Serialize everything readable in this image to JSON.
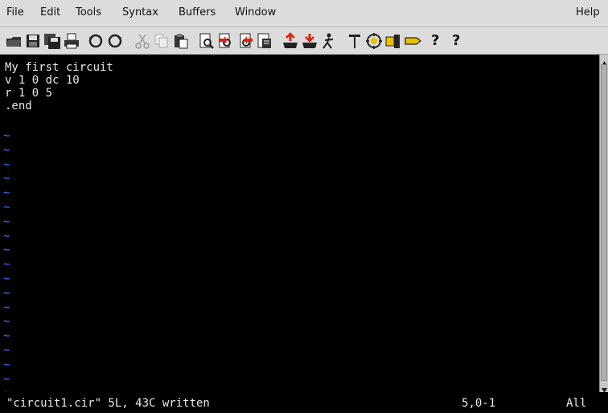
{
  "menubar": {
    "items": [
      "File",
      "Edit",
      "Tools",
      "Syntax",
      "Buffers",
      "Window"
    ],
    "help": "Help"
  },
  "toolbar": {
    "icons": [
      "open-icon",
      "save-icon",
      "save-all-icon",
      "print-icon",
      "undo-icon",
      "redo-icon",
      "cut-icon",
      "copy-icon",
      "paste-icon",
      "find-icon",
      "find-next-icon",
      "find-prev-icon",
      "load-session-icon",
      "save-session-icon",
      "run-script-icon",
      "make-icon",
      "shell-icon",
      "tags-icon",
      "jump-tag-icon",
      "ctags-icon",
      "tag-stack-icon",
      "help-icon",
      "find-help-icon"
    ],
    "help_glyph": "?",
    "find_help_glyph": "?"
  },
  "editor": {
    "lines": [
      "My first circuit",
      "v 1 0 dc 10",
      "r 1 0 5",
      ".end"
    ],
    "tilde_char": "~",
    "tilde_count": 19,
    "text_color": "#e8e8e8",
    "tilde_color": "#2f5fd8"
  },
  "status": {
    "message": "\"circuit1.cir\" 5L, 43C written",
    "position": "5,0-1",
    "scroll": "All"
  }
}
